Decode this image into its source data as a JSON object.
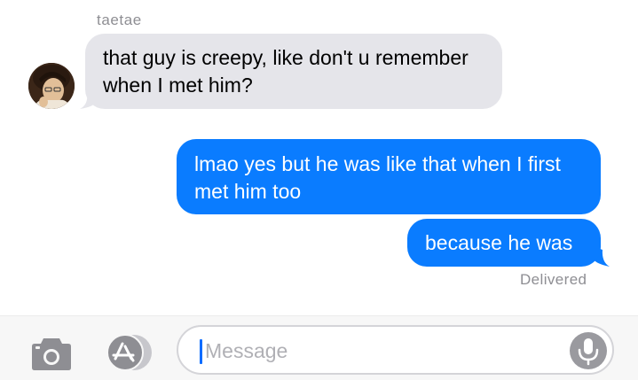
{
  "conversation": {
    "sender_name": "taetae",
    "messages": [
      {
        "direction": "incoming",
        "lines": [
          "that guy is creepy, like don't u remember",
          "when I met him?"
        ]
      },
      {
        "direction": "outgoing",
        "lines": [
          "lmao yes but he was like that when I first",
          "met him too"
        ]
      },
      {
        "direction": "outgoing",
        "lines": [
          "because he was"
        ]
      }
    ],
    "status": "Delivered"
  },
  "composer": {
    "placeholder": "Message",
    "icons": {
      "camera": "camera-icon",
      "apps": "app-store-icon",
      "mic": "microphone-icon"
    }
  },
  "colors": {
    "outgoing_bubble": "#0a7cff",
    "incoming_bubble": "#e5e5ea",
    "meta_text": "#8e8e93"
  }
}
